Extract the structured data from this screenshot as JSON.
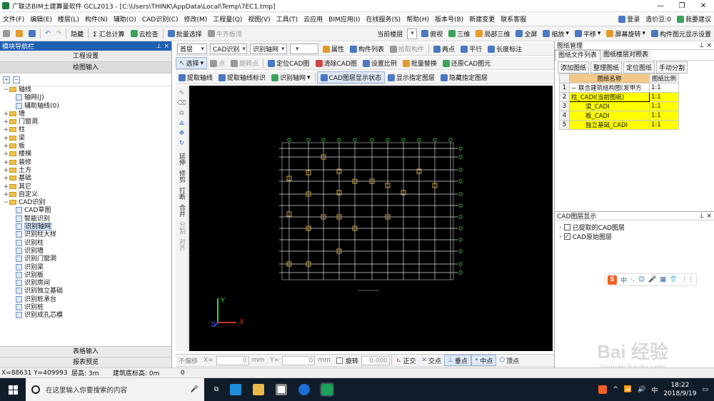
{
  "window": {
    "title": "广联达BIM土建算量软件 GCL2013 - [C:\\Users\\THINK\\AppData\\Local\\Temp\\7EC1.tmp]",
    "controls": [
      "—",
      "❐",
      "✕"
    ]
  },
  "menu": {
    "items": [
      "文件(F)",
      "编辑(E)",
      "楼层(L)",
      "构件(N)",
      "辅助(O)",
      "CAD识别(C)",
      "修改(M)",
      "工程量(Q)",
      "视图(V)",
      "工具(T)",
      "云应用",
      "BIM应用(I)",
      "在线服务(S)",
      "帮助(H)",
      "版本号(B)",
      "新建变更",
      "联系客服"
    ],
    "right": {
      "login": "登录",
      "price": "造价豆:0",
      "suggest": "我要建议"
    }
  },
  "toolbar1": {
    "items": [
      "隐藏",
      "Σ 汇总计算",
      "云检查",
      "批量选择",
      "平齐板顶"
    ],
    "floor_label": "当前楼层",
    "views": [
      "俯视",
      "三维",
      "局部三维",
      "全屏",
      "缩放",
      "平移",
      "屏幕旋转",
      "构件图元显示设置"
    ]
  },
  "nav_panel": {
    "title": "模块导航栏",
    "pin": "⊥ ×",
    "buttons": {
      "project_settings": "工程设置",
      "draw_input": "绘图输入",
      "table_input": "表格输入",
      "report_preview": "报表预览"
    },
    "tree": [
      {
        "label": "轴线",
        "level": 0,
        "type": "folder",
        "toggle": "−"
      },
      {
        "label": "轴网(J)",
        "level": 1,
        "type": "item"
      },
      {
        "label": "辅助轴线(0)",
        "level": 1,
        "type": "item"
      },
      {
        "label": "墙",
        "level": 0,
        "type": "folder",
        "toggle": "+"
      },
      {
        "label": "门窗洞",
        "level": 0,
        "type": "folder",
        "toggle": "+"
      },
      {
        "label": "柱",
        "level": 0,
        "type": "folder",
        "toggle": "+"
      },
      {
        "label": "梁",
        "level": 0,
        "type": "folder",
        "toggle": "+"
      },
      {
        "label": "板",
        "level": 0,
        "type": "folder",
        "toggle": "+"
      },
      {
        "label": "楼梯",
        "level": 0,
        "type": "folder",
        "toggle": "+"
      },
      {
        "label": "装修",
        "level": 0,
        "type": "folder",
        "toggle": "+"
      },
      {
        "label": "土方",
        "level": 0,
        "type": "folder",
        "toggle": "+"
      },
      {
        "label": "基础",
        "level": 0,
        "type": "folder",
        "toggle": "+"
      },
      {
        "label": "其它",
        "level": 0,
        "type": "folder",
        "toggle": "+"
      },
      {
        "label": "自定义",
        "level": 0,
        "type": "folder",
        "toggle": "+"
      },
      {
        "label": "CAD识别",
        "level": 0,
        "type": "folder",
        "toggle": "−"
      },
      {
        "label": "CAD草图",
        "level": 1,
        "type": "item"
      },
      {
        "label": "智能识别",
        "level": 1,
        "type": "item"
      },
      {
        "label": "识别轴网",
        "level": 1,
        "type": "item",
        "selected": true
      },
      {
        "label": "识别柱大样",
        "level": 1,
        "type": "item"
      },
      {
        "label": "识别柱",
        "level": 1,
        "type": "item"
      },
      {
        "label": "识别墙",
        "level": 1,
        "type": "item"
      },
      {
        "label": "识别门窗洞",
        "level": 1,
        "type": "item"
      },
      {
        "label": "识别梁",
        "level": 1,
        "type": "item"
      },
      {
        "label": "识别板",
        "level": 1,
        "type": "item"
      },
      {
        "label": "识别房间",
        "level": 1,
        "type": "item"
      },
      {
        "label": "识别独立基础",
        "level": 1,
        "type": "item"
      },
      {
        "label": "识别桩承台",
        "level": 1,
        "type": "item"
      },
      {
        "label": "识别桩",
        "level": 1,
        "type": "item"
      },
      {
        "label": "识别成孔芯模",
        "level": 1,
        "type": "item"
      }
    ]
  },
  "toolbar2": {
    "floor": "首层",
    "cad_type": "CAD识别",
    "mode": "识别轴网",
    "actions": [
      "属性",
      "构件列表",
      "拾取构件",
      "两点",
      "平行",
      "长度标注"
    ]
  },
  "toolbar3": {
    "items": [
      "选择",
      "点",
      "旋转点",
      "定位CAD图",
      "清除CAD图",
      "设置比例",
      "批量替换",
      "还原CAD图元"
    ]
  },
  "toolbar4": {
    "items": [
      "提取轴线",
      "提取轴线标识",
      "识别轴网",
      "CAD图层显示状态",
      "显示指定图层",
      "隐藏指定图层"
    ]
  },
  "vertical_tools": [
    "延伸",
    "修剪",
    "打断",
    "合并",
    "分割",
    "对齐"
  ],
  "canvas": {
    "background": "#000000",
    "grid_color": "#d8d8d8",
    "axis_color": "#3ad04a",
    "column_color": "#e8b33a",
    "axes": {
      "y": "Y",
      "x": "X",
      "z": "Z"
    }
  },
  "right_panel": {
    "title": "图纸管理",
    "pin": "⊥ ×",
    "tabs": [
      "图纸文件列表",
      "图纸楼层对照表"
    ],
    "buttons": [
      "添加图纸",
      "整理图纸",
      "定位图纸",
      "手动分割"
    ],
    "columns": [
      "图纸名称",
      "图纸比例"
    ],
    "rows": [
      {
        "no": "1",
        "name": "联合建筑结构图(发甲方",
        "scale": "1:1",
        "toggle": "−",
        "style": "normal"
      },
      {
        "no": "2",
        "name": "柱_CADI(当前图纸)",
        "scale": "1:1",
        "style": "current"
      },
      {
        "no": "3",
        "name": "梁_CADI",
        "scale": "1:1",
        "style": "yellow"
      },
      {
        "no": "4",
        "name": "板_CADI",
        "scale": "1:1",
        "style": "yellow"
      },
      {
        "no": "5",
        "name": "独立基础_CADI",
        "scale": "1:1",
        "style": "yellow"
      }
    ]
  },
  "layer_panel": {
    "title": "CAD图层显示",
    "pin": "⊥ ×",
    "items": [
      {
        "label": "已提取的CAD图层",
        "checked": false
      },
      {
        "label": "CAD原始图层",
        "checked": true
      }
    ]
  },
  "ime_bar": {
    "items": [
      "S",
      "中",
      "·,",
      "☺",
      "🎤",
      "▦",
      "👕",
      "⋮⋮"
    ]
  },
  "snap_bar": {
    "offset": "不偏移",
    "x_label": "X=",
    "x_value": "0",
    "unit1": "mm",
    "y_label": "Y=",
    "y_value": "0",
    "unit2": "mm",
    "rotate_label": "旋转",
    "rotate_value": "0.000",
    "items": [
      "正交",
      "交点",
      "垂点",
      "中点",
      "顶点"
    ]
  },
  "statusbar": {
    "coords": "X=88631 Y=409993",
    "height": "层高: 3m",
    "base": "建筑底标高: 0m",
    "extra": "0"
  },
  "taskbar": {
    "search": "在这里输入你要搜索的内容",
    "time": "18:22",
    "date": "2018/9/19",
    "lang": "中",
    "tray": [
      "^",
      "📶",
      "🔊"
    ]
  },
  "watermark": {
    "text": "Bai 经验",
    "sub": "jingyan.baidu.com"
  }
}
